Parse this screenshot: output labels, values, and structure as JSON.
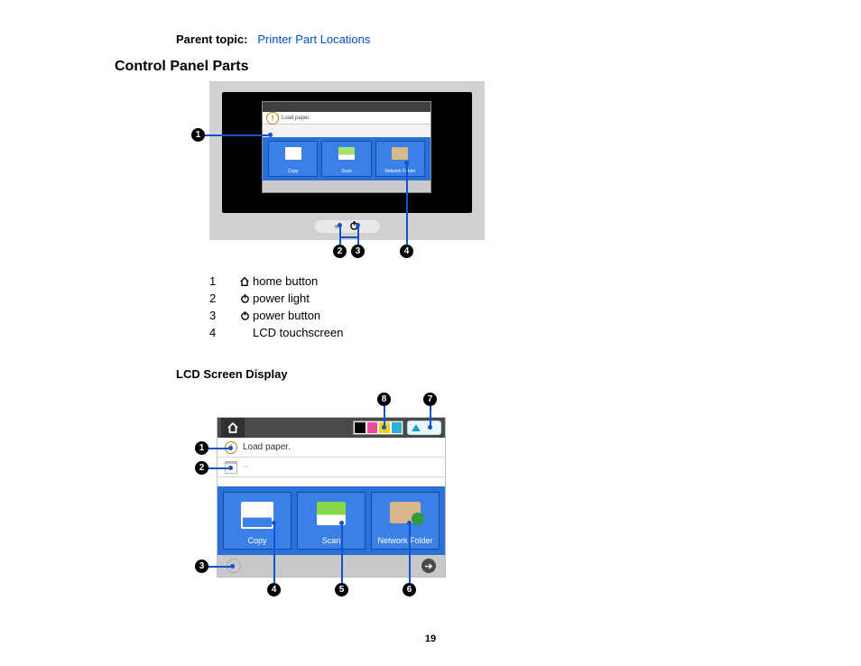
{
  "parent_topic_label": "Parent topic:",
  "parent_topic_link": "Printer Part Locations",
  "heading": "Control Panel Parts",
  "subheading": "LCD Screen Display",
  "page_number": "19",
  "legend1": [
    {
      "n": "1",
      "icon": "home",
      "text": "home button"
    },
    {
      "n": "2",
      "icon": "power",
      "text": "power light"
    },
    {
      "n": "3",
      "icon": "power",
      "text": "power button"
    },
    {
      "n": "4",
      "icon": "",
      "text": "LCD touchscreen"
    }
  ],
  "screen": {
    "load_paper": "Load paper.",
    "dashes": "--",
    "tiles": {
      "copy": "Copy",
      "scan": "Scan",
      "network_folder": "Network Folder"
    }
  },
  "fig1_callouts": [
    "1",
    "2",
    "3",
    "4"
  ],
  "fig2_callouts": [
    "1",
    "2",
    "3",
    "4",
    "5",
    "6",
    "7",
    "8"
  ]
}
